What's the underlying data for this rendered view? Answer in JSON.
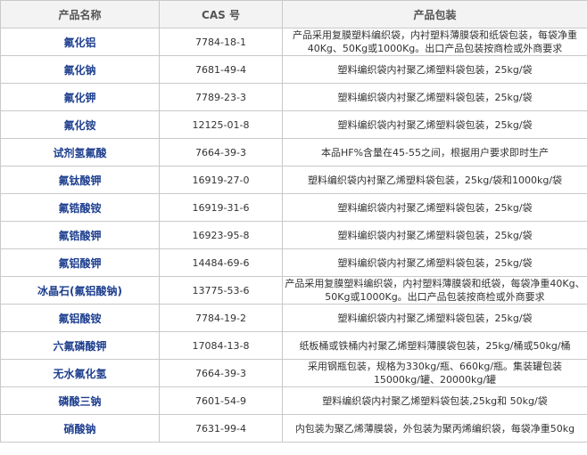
{
  "table": {
    "headers": [
      "产品名称",
      "CAS 号",
      "产品包装"
    ],
    "rows": [
      {
        "name": "氟化铝",
        "cas": "7784-18-1",
        "packaging": "产品采用复膜塑料编织袋，内衬塑料薄膜袋和纸袋包装，每袋净重40Kg、50Kg或1000Kg。出口产品包装按商检或外商要求"
      },
      {
        "name": "氟化钠",
        "cas": "7681-49-4",
        "packaging": "塑料编织袋内衬聚乙烯塑料袋包装，25kg/袋"
      },
      {
        "name": "氟化钾",
        "cas": "7789-23-3",
        "packaging": "塑料编织袋内衬聚乙烯塑料袋包装，25kg/袋"
      },
      {
        "name": "氟化铵",
        "cas": "12125-01-8",
        "packaging": "塑料编织袋内衬聚乙烯塑料袋包装，25kg/袋"
      },
      {
        "name": "试剂氢氟酸",
        "cas": "7664-39-3",
        "packaging": "本品HF%含量在45-55之间，根据用户要求即时生产"
      },
      {
        "name": "氟钛酸钾",
        "cas": "16919-27-0",
        "packaging": "塑料编织袋内衬聚乙烯塑料袋包装，25kg/袋和1000kg/袋"
      },
      {
        "name": "氟锆酸铵",
        "cas": "16919-31-6",
        "packaging": "塑料编织袋内衬聚乙烯塑料袋包装，25kg/袋"
      },
      {
        "name": "氟锆酸钾",
        "cas": "16923-95-8",
        "packaging": "塑料编织袋内衬聚乙烯塑料袋包装，25kg/袋"
      },
      {
        "name": "氟铝酸钾",
        "cas": "14484-69-6",
        "packaging": "塑料编织袋内衬聚乙烯塑料袋包装，25kg/袋"
      },
      {
        "name": "冰晶石(氟铝酸钠)",
        "cas": "13775-53-6",
        "packaging": "产品采用复膜塑料编织袋，内衬塑料薄膜袋和纸袋，每袋净重40Kg、50Kg或1000Kg。出口产品包装按商检或外商要求"
      },
      {
        "name": "氟铝酸铵",
        "cas": "7784-19-2",
        "packaging": "塑料编织袋内衬聚乙烯塑料袋包装，25kg/袋"
      },
      {
        "name": "六氟磷酸钾",
        "cas": "17084-13-8",
        "packaging": "纸板桶或铁桶内衬聚乙烯塑料薄膜袋包装，25kg/桶或50kg/桶"
      },
      {
        "name": "无水氟化氢",
        "cas": "7664-39-3",
        "packaging": "采用钢瓶包装，规格为330kg/瓶、660kg/瓶。集装罐包装15000kg/罐、20000kg/罐"
      },
      {
        "name": "磷酸三钠",
        "cas": "7601-54-9",
        "packaging": "塑料编织袋内衬聚乙烯塑料袋包装,25kg和 50kg/袋"
      },
      {
        "name": "硝酸钠",
        "cas": "7631-99-4",
        "packaging": "内包装为聚乙烯薄膜袋，外包装为聚丙烯编织袋，每袋净重50kg"
      }
    ]
  }
}
